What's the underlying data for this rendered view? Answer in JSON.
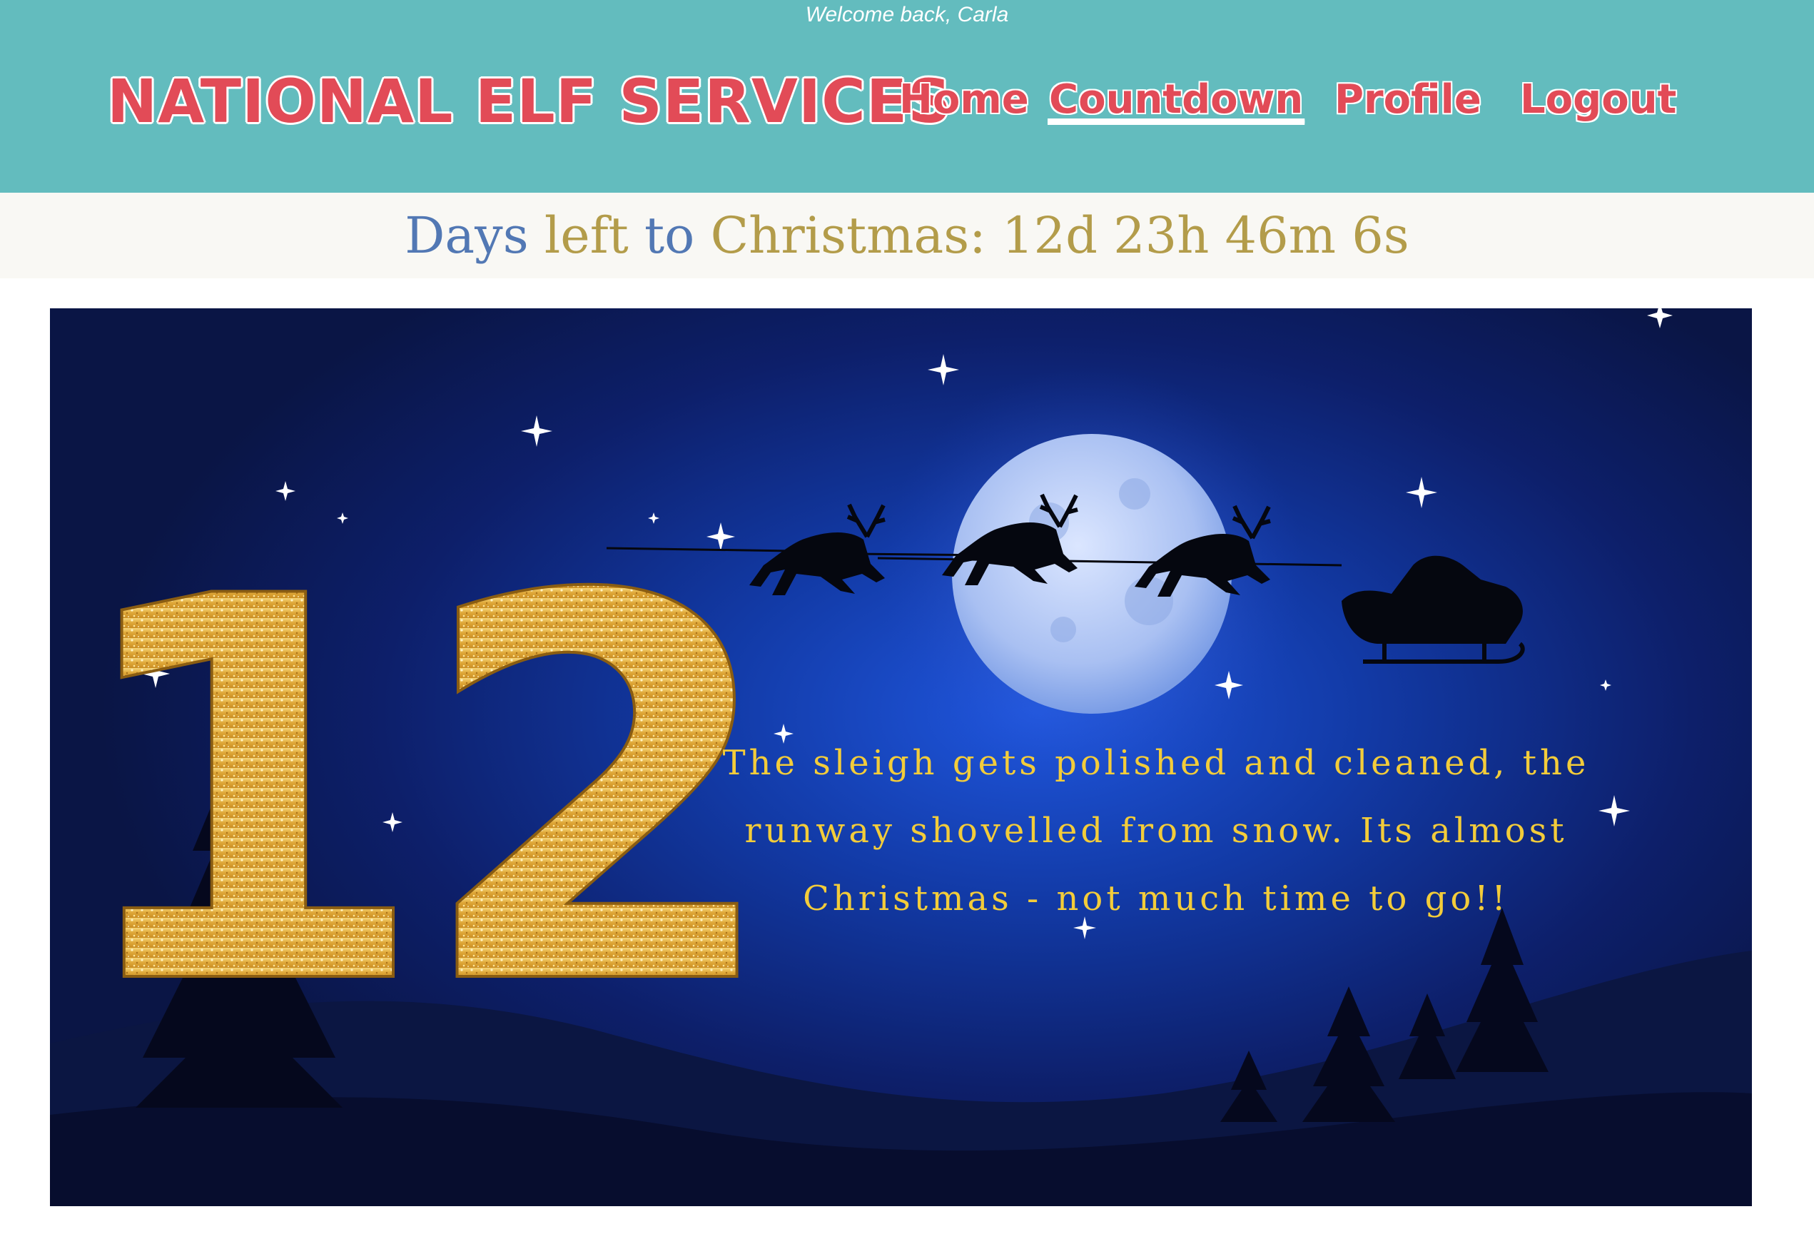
{
  "header": {
    "welcome": "Welcome back, Carla",
    "brand": "NATIONAL ELF SERVICES",
    "nav": [
      {
        "label": "Home",
        "active": false
      },
      {
        "label": "Countdown",
        "active": true
      },
      {
        "label": "Profile",
        "active": false
      },
      {
        "label": "Logout",
        "active": false
      }
    ]
  },
  "countdown": {
    "label_days": "Days",
    "label_left": "left",
    "label_to": "to",
    "label_christmas": "Christmas:",
    "value": "12d 23h 46m 6s"
  },
  "banner": {
    "day_number": "12",
    "message": "The sleigh gets polished and cleaned, the\nrunway shovelled from snow. Its almost\nChristmas - not much time to go!!"
  },
  "colors": {
    "header_bg": "#63bcbe",
    "brand": "#e24b57",
    "countdown_blue": "#5278b4",
    "countdown_gold": "#b39c4a",
    "banner_text": "#f3cc3a"
  }
}
